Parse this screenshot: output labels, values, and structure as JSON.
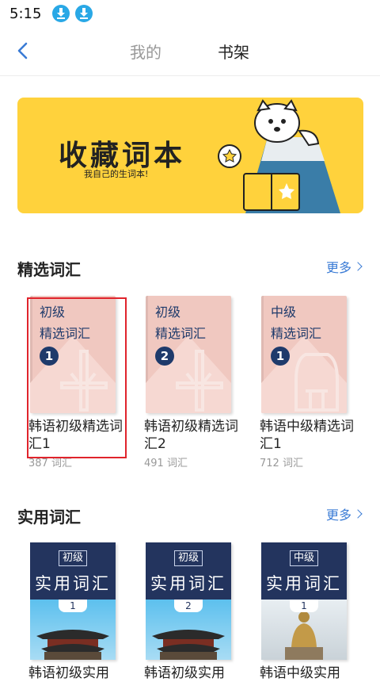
{
  "status_bar": {
    "time": "5:15",
    "icons": [
      "download-icon",
      "download-icon"
    ]
  },
  "nav": {
    "tab_mine": "我的",
    "tab_shelf": "书架",
    "active": "书架"
  },
  "banner": {
    "title": "收藏词本",
    "subtitle": "我自己的生词本!"
  },
  "section_featured": {
    "title": "精选词汇",
    "more": "更多",
    "books": [
      {
        "cover_level": "初级",
        "cover_name": "精选词汇",
        "number": "1",
        "title": "韩语初级精选词汇1",
        "count": "387 词汇"
      },
      {
        "cover_level": "初级",
        "cover_name": "精选词汇",
        "number": "2",
        "title": "韩语初级精选词汇2",
        "count": "491 词汇"
      },
      {
        "cover_level": "中级",
        "cover_name": "精选词汇",
        "number": "1",
        "title": "韩语中级精选词汇1",
        "count": "712 词汇"
      }
    ]
  },
  "section_practical": {
    "title": "实用词汇",
    "more": "更多",
    "books": [
      {
        "cover_level": "初级",
        "cover_name": "实用词汇",
        "number": "1",
        "title": "韩语初级实用"
      },
      {
        "cover_level": "初级",
        "cover_name": "实用词汇",
        "number": "2",
        "title": "韩语初级实用"
      },
      {
        "cover_level": "中级",
        "cover_name": "实用词汇",
        "number": "1",
        "title": "韩语中级实用"
      }
    ]
  },
  "colors": {
    "accent": "#3a7bd5",
    "banner": "#ffd23c",
    "cover_pink": "#f0c8c0",
    "cover_navy": "#23345e",
    "highlight": "#e0242c"
  }
}
